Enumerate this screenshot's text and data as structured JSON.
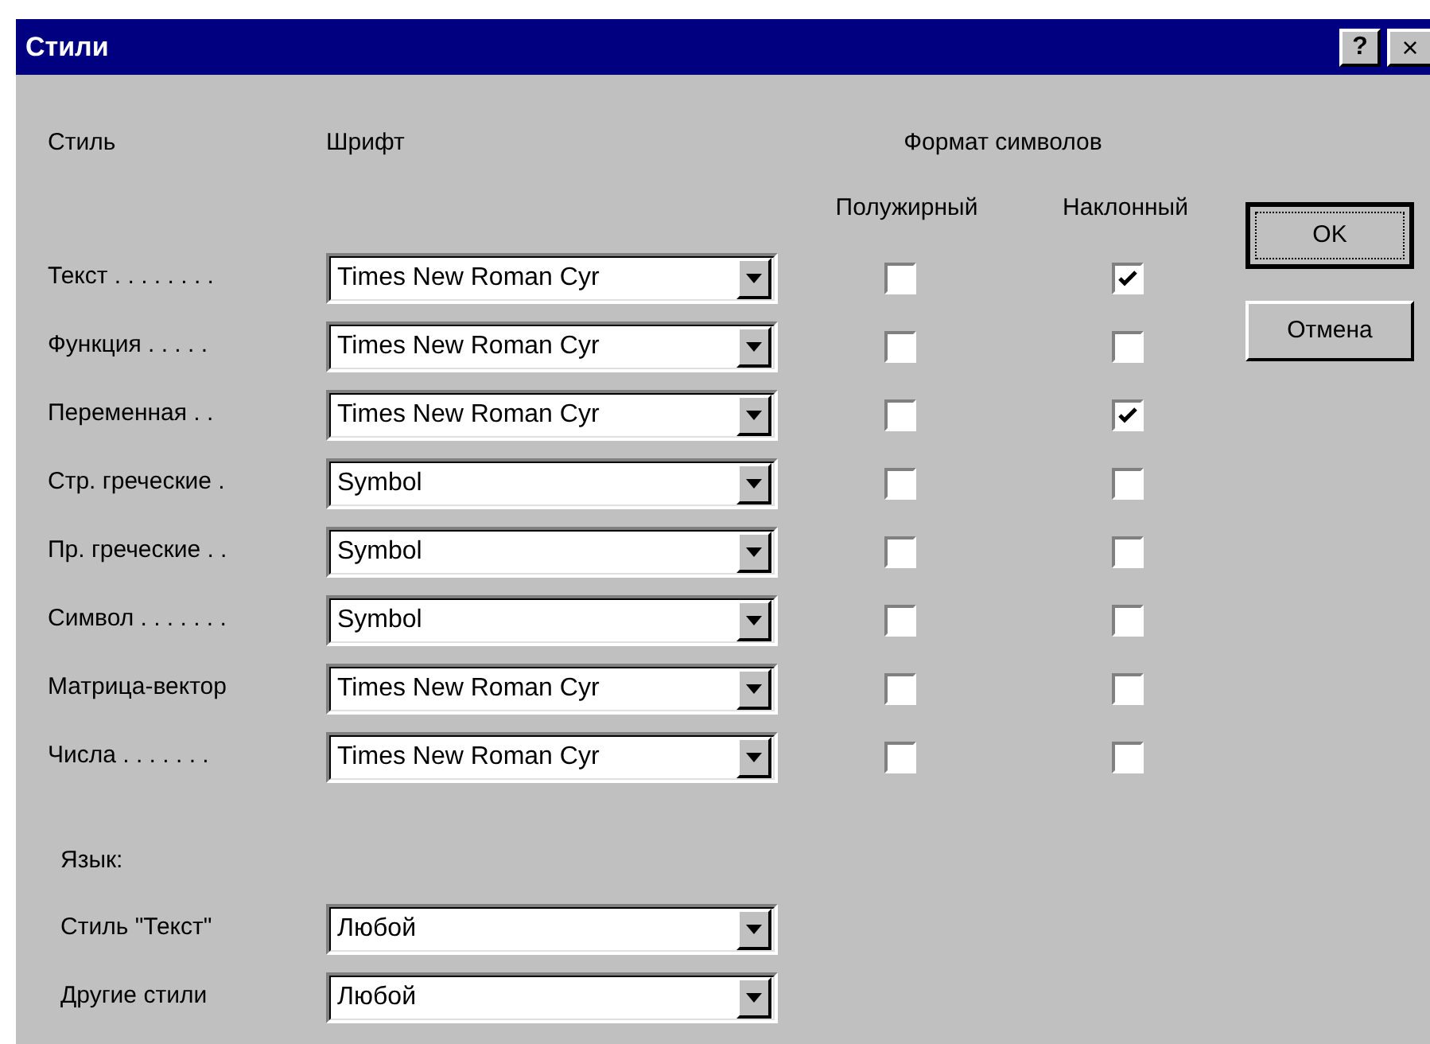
{
  "window": {
    "title": "Стили",
    "help_button": "?",
    "close_button": "×"
  },
  "headers": {
    "style": "Стиль",
    "font": "Шрифт",
    "format": "Формат символов",
    "bold": "Полужирный",
    "italic": "Наклонный"
  },
  "styles": [
    {
      "name": "Текст . . . . . . . .",
      "font": "Times New Roman Cyr",
      "bold": false,
      "italic": true
    },
    {
      "name": "Функция . . . . .",
      "font": "Times New Roman Cyr",
      "bold": false,
      "italic": false
    },
    {
      "name": "Переменная . .",
      "font": "Times New Roman Cyr",
      "bold": false,
      "italic": true
    },
    {
      "name": "Стр. греческие .",
      "font": "Symbol",
      "bold": false,
      "italic": false
    },
    {
      "name": "Пр. греческие . .",
      "font": "Symbol",
      "bold": false,
      "italic": false
    },
    {
      "name": "Символ . . . . . . .",
      "font": "Symbol",
      "bold": false,
      "italic": false
    },
    {
      "name": "Матрица-вектор",
      "font": "Times New Roman Cyr",
      "bold": false,
      "italic": false
    },
    {
      "name": "Числа . . . . . . .",
      "font": "Times New Roman Cyr",
      "bold": false,
      "italic": false
    }
  ],
  "language": {
    "label": "Язык:",
    "rows": [
      {
        "name": "Стиль \"Текст\"",
        "value": "Любой"
      },
      {
        "name": "Другие стили",
        "value": "Любой"
      }
    ]
  },
  "buttons": [
    {
      "label": "OK",
      "default": true
    },
    {
      "label": "Отмена",
      "default": false
    }
  ]
}
